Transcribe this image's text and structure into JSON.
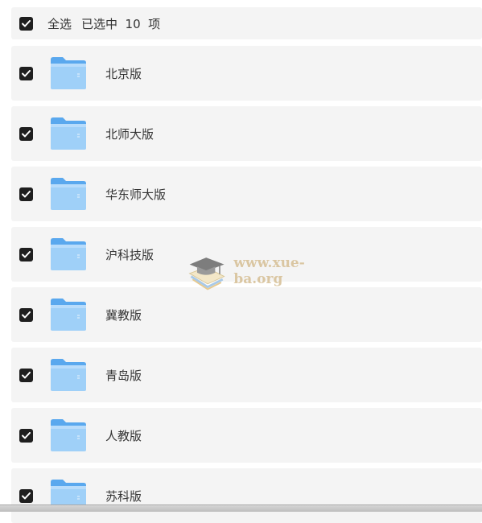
{
  "header": {
    "select_all_label": "全选",
    "selected_count_text": "已选中  10  项",
    "checked": true
  },
  "items": [
    {
      "name": "北京版",
      "checked": true,
      "icon": "folder-icon"
    },
    {
      "name": "北师大版",
      "checked": true,
      "icon": "folder-icon"
    },
    {
      "name": "华东师大版",
      "checked": true,
      "icon": "folder-icon"
    },
    {
      "name": "沪科技版",
      "checked": true,
      "icon": "folder-icon"
    },
    {
      "name": "冀教版",
      "checked": true,
      "icon": "folder-icon"
    },
    {
      "name": "青岛版",
      "checked": true,
      "icon": "folder-icon"
    },
    {
      "name": "人教版",
      "checked": true,
      "icon": "folder-icon"
    },
    {
      "name": "苏科版",
      "checked": true,
      "icon": "folder-icon"
    }
  ],
  "watermark": {
    "text": "www.xue-ba.org",
    "icon": "graduation-cap-logo"
  },
  "colors": {
    "row_bg": "#f4f4f4",
    "checkbox_bg": "#1f1f1f",
    "folder_light": "#9fd0f8",
    "folder_dark": "#5aa8ee",
    "text": "#333333"
  }
}
